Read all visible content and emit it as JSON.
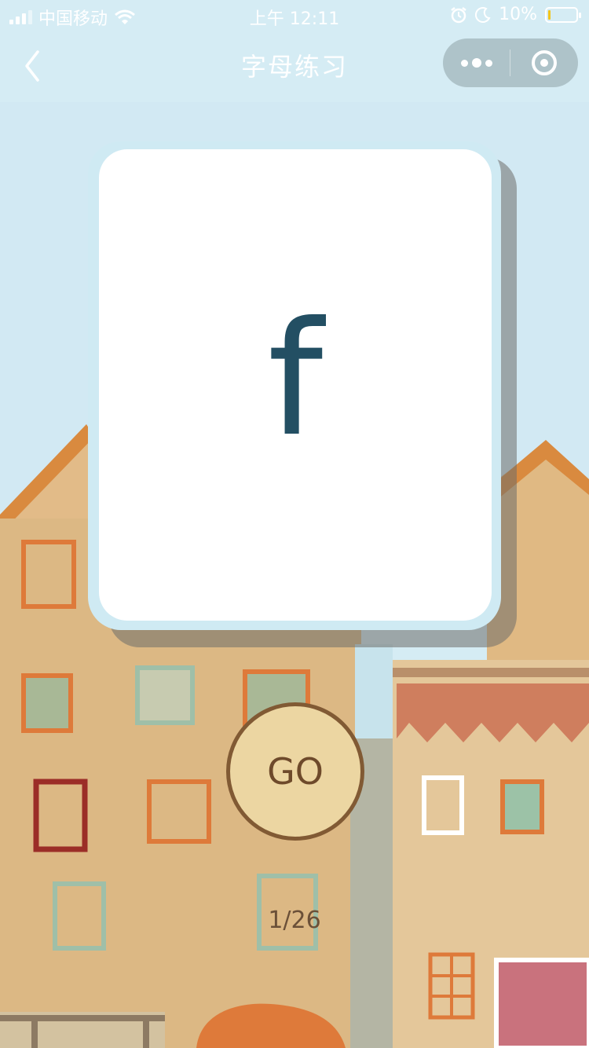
{
  "status_bar": {
    "carrier": "中国移动",
    "time": "上午 12:11",
    "battery_text": "10%",
    "battery_level": 0.1,
    "icons": [
      "signal-icon",
      "wifi-icon",
      "alarm-icon",
      "moon-icon",
      "battery-icon"
    ]
  },
  "nav": {
    "title": "字母练习",
    "back_icon": "chevron-left-icon",
    "more_icon": "more-dots-icon",
    "close_icon": "target-circle-icon"
  },
  "card": {
    "letter": "f"
  },
  "go_button": {
    "label": "GO"
  },
  "progress": {
    "text": "1/26"
  },
  "colors": {
    "sky": "#d5ecf4",
    "card_text": "#234f63",
    "go_fill": "#ecd6a2",
    "go_border": "#815a34",
    "battery_low": "#f2c51b"
  }
}
